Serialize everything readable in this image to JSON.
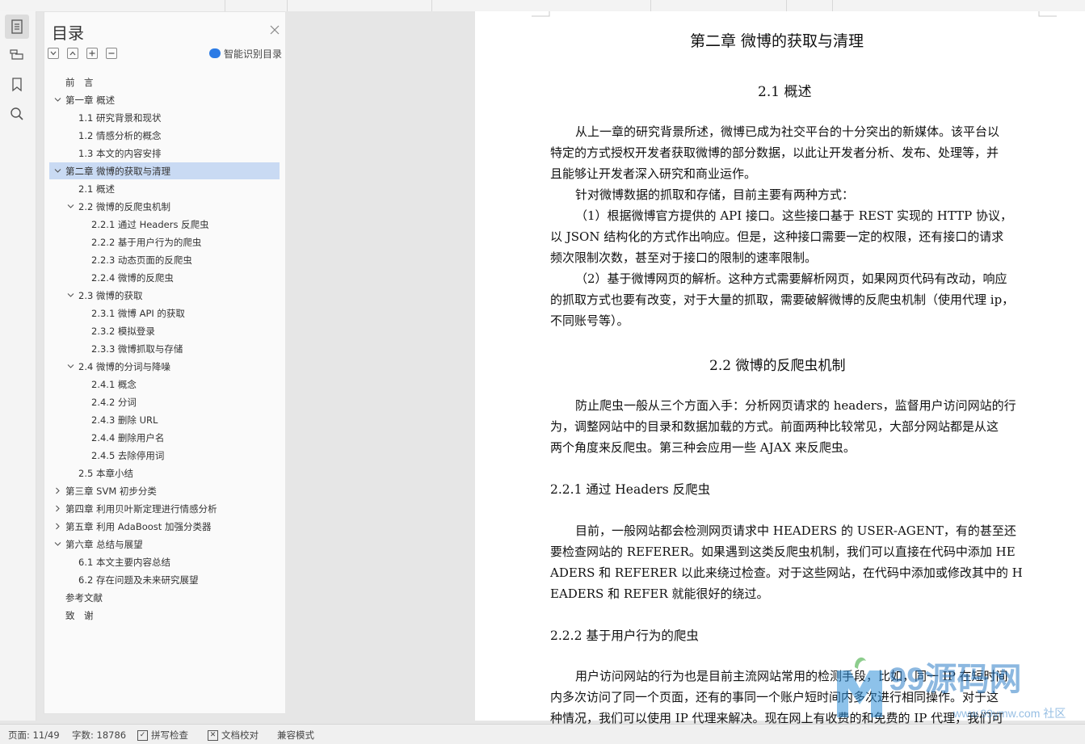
{
  "toc": {
    "title": "目录",
    "smart_label": "智能识别目录",
    "items": [
      {
        "label": "前　言",
        "level": 0,
        "expander": "none"
      },
      {
        "label": "第一章  概述",
        "level": 0,
        "expander": "open"
      },
      {
        "label": "1.1  研究背景和现状",
        "level": 1,
        "expander": "none"
      },
      {
        "label": "1.2  情感分析的概念",
        "level": 1,
        "expander": "none"
      },
      {
        "label": "1.3  本文的内容安排",
        "level": 1,
        "expander": "none"
      },
      {
        "label": "第二章  微博的获取与清理",
        "level": 0,
        "expander": "open",
        "selected": true
      },
      {
        "label": "2.1  概述",
        "level": 1,
        "expander": "none"
      },
      {
        "label": "2.2  微博的反爬虫机制",
        "level": 1,
        "expander": "open"
      },
      {
        "label": "2.2.1  通过 Headers 反爬虫",
        "level": 2,
        "expander": "none"
      },
      {
        "label": "2.2.2  基于用户行为的爬虫",
        "level": 2,
        "expander": "none"
      },
      {
        "label": "2.2.3  动态页面的反爬虫",
        "level": 2,
        "expander": "none"
      },
      {
        "label": "2.2.4  微博的反爬虫",
        "level": 2,
        "expander": "none"
      },
      {
        "label": "2.3  微博的获取",
        "level": 1,
        "expander": "open"
      },
      {
        "label": "2.3.1  微博 API 的获取",
        "level": 2,
        "expander": "none"
      },
      {
        "label": "2.3.2  模拟登录",
        "level": 2,
        "expander": "none"
      },
      {
        "label": "2.3.3  微博抓取与存储",
        "level": 2,
        "expander": "none"
      },
      {
        "label": "2.4  微博的分词与降噪",
        "level": 1,
        "expander": "open"
      },
      {
        "label": "2.4.1  概念",
        "level": 2,
        "expander": "none"
      },
      {
        "label": "2.4.2  分词",
        "level": 2,
        "expander": "none"
      },
      {
        "label": "2.4.3  删除 URL",
        "level": 2,
        "expander": "none"
      },
      {
        "label": "2.4.4  删除用户名",
        "level": 2,
        "expander": "none"
      },
      {
        "label": "2.4.5  去除停用词",
        "level": 2,
        "expander": "none"
      },
      {
        "label": "2.5  本章小结",
        "level": 1,
        "expander": "none"
      },
      {
        "label": "第三章  SVM 初步分类",
        "level": 0,
        "expander": "closed"
      },
      {
        "label": "第四章  利用贝叶斯定理进行情感分析",
        "level": 0,
        "expander": "closed"
      },
      {
        "label": "第五章  利用 AdaBoost 加强分类器",
        "level": 0,
        "expander": "closed"
      },
      {
        "label": "第六章  总结与展望",
        "level": 0,
        "expander": "open"
      },
      {
        "label": "6.1  本文主要内容总结",
        "level": 1,
        "expander": "none"
      },
      {
        "label": "6.2  存在问题及未来研究展望",
        "level": 1,
        "expander": "none"
      },
      {
        "label": "参考文献",
        "level": 0,
        "expander": "none"
      },
      {
        "label": "致　谢",
        "level": 0,
        "expander": "none"
      }
    ]
  },
  "document": {
    "chapter_title": "第二章  微博的获取与清理",
    "s21_title": "2.1  概述",
    "s21_lines": [
      "从上一章的研究背景所述，微博已成为社交平台的十分突出的新媒体。该平台以",
      "特定的方式授权开发者获取微博的部分数据，以此让开发者分析、发布、处理等，并",
      "且能够让开发者深入研究和商业运作。",
      "针对微博数据的抓取和存储，目前主要有两种方式：",
      "（1）根据微博官方提供的 API 接口。这些接口基于 REST 实现的 HTTP 协议，",
      "以 JSON 结构化的方式作出响应。但是，这种接口需要一定的权限，还有接口的请求",
      "频次限制次数，甚至对于接口的限制的速率限制。",
      "（2）基于微博网页的解析。这种方式需要解析网页，如果网页代码有改动，响应",
      "的抓取方式也要有改变，对于大量的抓取，需要破解微博的反爬虫机制（使用代理 ip，",
      "不同账号等）。"
    ],
    "s22_title": "2.2  微博的反爬虫机制",
    "s22_lines": [
      "防止爬虫一般从三个方面入手：分析网页请求的 headers，监督用户访问网站的行",
      "为，调整网站中的目录和数据加载的方式。前面两种比较常见，大部分网站都是从这",
      "两个角度来反爬虫。第三种会应用一些 AJAX 来反爬虫。"
    ],
    "s221_title": "2.2.1  通过 Headers 反爬虫",
    "s221_lines": [
      "目前，一般网站都会检测网页请求中 HEADERS 的 USER-AGENT，有的甚至还",
      "要检查网站的 REFERER。如果遇到这类反爬虫机制，我们可以直接在代码中添加 HE",
      "ADERS 和 REFERER 以此来绕过检查。对于这些网站，在代码中添加或修改其中的 H",
      "EADERS 和 REFER 就能很好的绕过。"
    ],
    "s222_title": "2.2.2  基于用户行为的爬虫",
    "s222_lines": [
      "用户访问网站的行为也是目前主流网站常用的检测手段，比如，同一 IP 在短时间",
      "内多次访问了同一个页面，还有的事同一个账户短时间内多次进行相同操作。对于这",
      "种情况，我们可以使用 IP 代理来解决。现在网上有收费的和免费的 IP 代理，我们可"
    ]
  },
  "status": {
    "page": "页面: 11/49",
    "words": "字数: 18786",
    "spell": "拼写检查",
    "proof": "文档校对",
    "compat": "兼容模式"
  },
  "watermark": {
    "text": "99源码网",
    "sub": "www.99ymw.com 社区"
  }
}
